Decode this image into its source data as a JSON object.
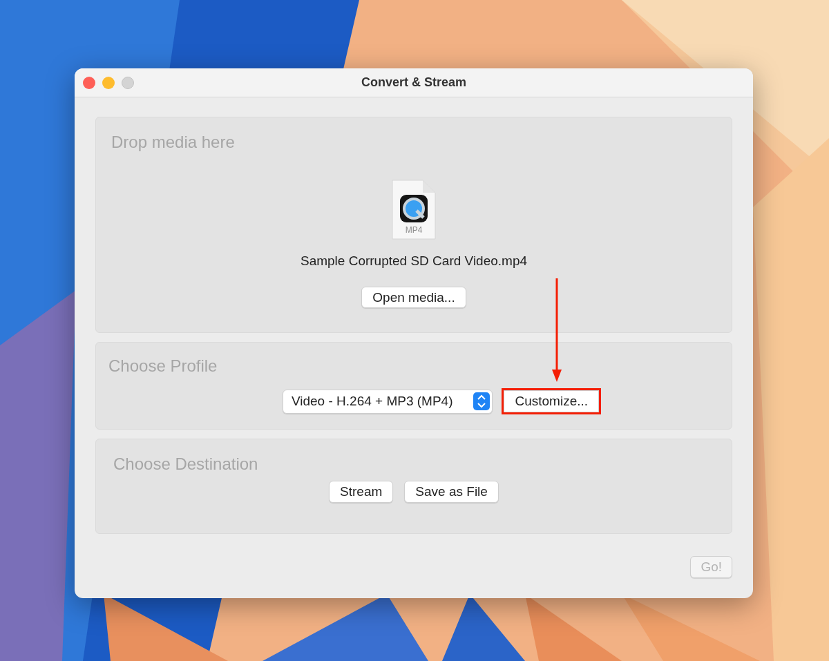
{
  "window": {
    "title": "Convert & Stream"
  },
  "traffic_lights": [
    {
      "color": "#fe5f57",
      "disabled": false
    },
    {
      "color": "#febc2e",
      "disabled": false
    },
    {
      "color": "#d4d4d4",
      "disabled": true
    }
  ],
  "drop_panel": {
    "heading": "Drop media here",
    "file": {
      "type": "MP4",
      "name": "Sample Corrupted SD Card Video.mp4"
    },
    "button": {
      "label": "Open media...",
      "disabled": false,
      "highlighted": false
    }
  },
  "profile_panel": {
    "heading": "Choose Profile",
    "select": {
      "value": "Video - H.264 + MP3 (MP4)"
    },
    "button": {
      "label": "Customize...",
      "disabled": false,
      "highlighted": true
    }
  },
  "destination_panel": {
    "heading": "Choose Destination",
    "buttons": [
      {
        "label": "Stream",
        "disabled": false,
        "highlighted": false
      },
      {
        "label": "Save as File",
        "disabled": false,
        "highlighted": false
      }
    ]
  },
  "go_button": {
    "label": "Go!",
    "disabled": true,
    "highlighted": false
  }
}
